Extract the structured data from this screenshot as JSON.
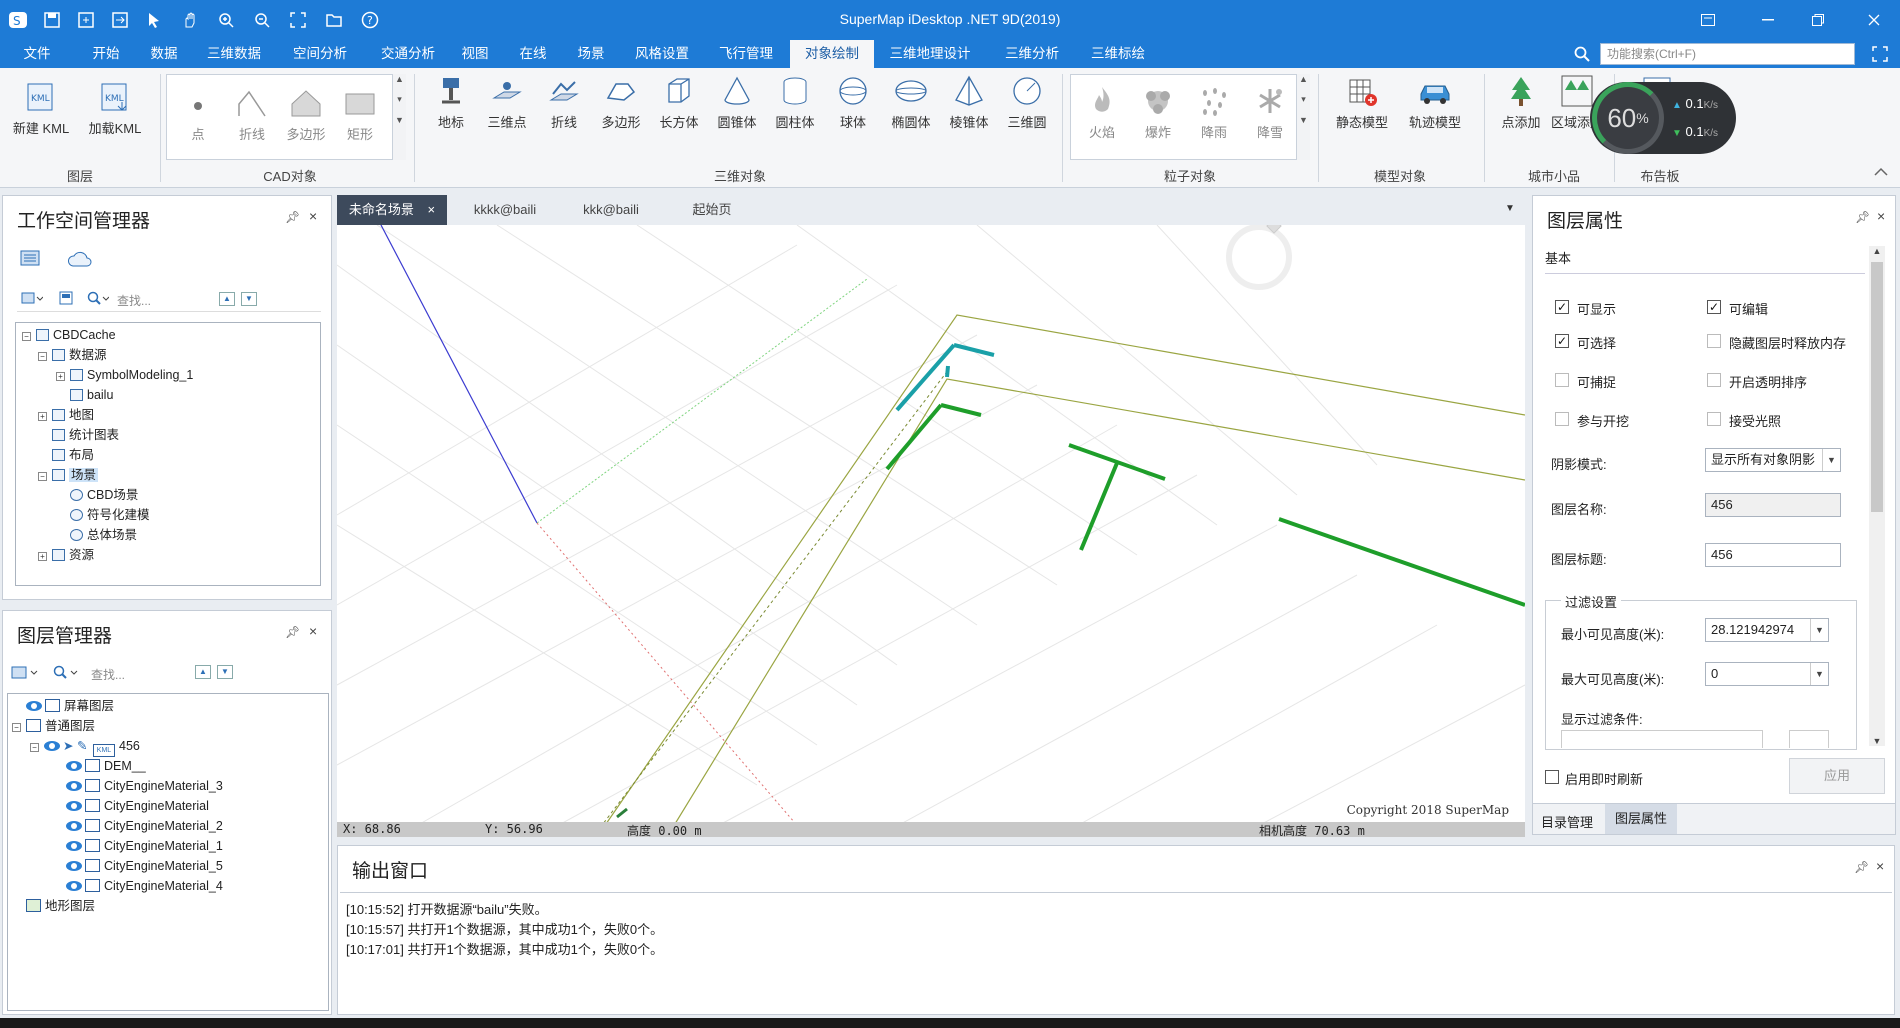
{
  "window": {
    "title": "SuperMap iDesktop .NET 9D(2019)"
  },
  "menu": {
    "items": [
      "文件",
      "开始",
      "数据",
      "三维数据",
      "空间分析",
      "交通分析",
      "视图",
      "在线",
      "场景",
      "风格设置",
      "飞行管理",
      "对象绘制",
      "三维地理设计",
      "三维分析",
      "三维标绘"
    ],
    "active": "对象绘制",
    "search_placeholder": "功能搜索(Ctrl+F)"
  },
  "ribbon": {
    "layer_group": {
      "label": "图层",
      "buttons": [
        "新建 KML",
        "加载KML"
      ]
    },
    "cad_group": {
      "label": "CAD对象",
      "buttons": [
        "点",
        "折线",
        "多边形",
        "矩形"
      ]
    },
    "obj3d_group": {
      "label": "三维对象",
      "buttons": [
        "地标",
        "三维点",
        "折线",
        "多边形",
        "长方体",
        "圆锥体",
        "圆柱体",
        "球体",
        "椭圆体",
        "棱锥体",
        "三维圆"
      ]
    },
    "particle_group": {
      "label": "粒子对象",
      "buttons": [
        "火焰",
        "爆炸",
        "降雨",
        "降雪"
      ]
    },
    "model_group": {
      "label": "模型对象",
      "buttons": [
        "静态模型",
        "轨迹模型"
      ]
    },
    "city_group": {
      "label": "城市小品",
      "buttons": [
        "点添加",
        "区域添加"
      ]
    },
    "billboard_group": {
      "label": "布告板"
    },
    "net_meter": {
      "percent": "60",
      "unit": "%",
      "up": "0.1",
      "down": "0.1",
      "rate_unit": "K/s"
    }
  },
  "workspace": {
    "title": "工作空间管理器",
    "search_placeholder": "查找...",
    "tree": [
      {
        "label": "CBDCache",
        "level": 0,
        "exp": "−"
      },
      {
        "label": "数据源",
        "level": 1,
        "exp": "−"
      },
      {
        "label": "SymbolModeling_1",
        "level": 2,
        "exp": "+"
      },
      {
        "label": "bailu",
        "level": 2,
        "exp": ""
      },
      {
        "label": "地图",
        "level": 1,
        "exp": "+"
      },
      {
        "label": "统计图表",
        "level": 1,
        "exp": ""
      },
      {
        "label": "布局",
        "level": 1,
        "exp": ""
      },
      {
        "label": "场景",
        "level": 1,
        "exp": "−",
        "selected": true
      },
      {
        "label": "CBD场景",
        "level": 2,
        "exp": ""
      },
      {
        "label": "符号化建模",
        "level": 2,
        "exp": ""
      },
      {
        "label": "总体场景",
        "level": 2,
        "exp": ""
      },
      {
        "label": "资源",
        "level": 1,
        "exp": "+"
      }
    ]
  },
  "layers": {
    "title": "图层管理器",
    "search_placeholder": "查找...",
    "tree": [
      {
        "label": "屏幕图层",
        "level": 0,
        "eye": true
      },
      {
        "label": "普通图层",
        "level": 0,
        "eye": false
      },
      {
        "label": "456",
        "level": 1,
        "eye": true,
        "kml": true
      },
      {
        "label": "DEM__",
        "level": 2,
        "eye": true
      },
      {
        "label": "CityEngineMaterial_3",
        "level": 2,
        "eye": true
      },
      {
        "label": "CityEngineMaterial",
        "level": 2,
        "eye": true
      },
      {
        "label": "CityEngineMaterial_2",
        "level": 2,
        "eye": true
      },
      {
        "label": "CityEngineMaterial_1",
        "level": 2,
        "eye": true
      },
      {
        "label": "CityEngineMaterial_5",
        "level": 2,
        "eye": true
      },
      {
        "label": "CityEngineMaterial_4",
        "level": 2,
        "eye": true
      },
      {
        "label": "地形图层",
        "level": 0,
        "eye": false
      }
    ]
  },
  "doc_tabs": [
    "未命名场景",
    "kkkk@baili",
    "kkk@baili",
    "起始页"
  ],
  "doc_tab_close": "×",
  "viewport": {
    "copyright": "Copyright 2018 SuperMap",
    "status": {
      "x": "X: 68.86",
      "y": "Y: 56.96",
      "height": "高度 0.00 m",
      "cam": "相机高度 70.63 m"
    }
  },
  "output": {
    "title": "输出窗口",
    "lines": [
      "[10:15:52] 打开数据源“bailu”失败。",
      "[10:15:57] 共打开1个数据源，其中成功1个，失败0个。",
      "[10:17:01] 共打开1个数据源，其中成功1个，失败0个。"
    ]
  },
  "props": {
    "title": "图层属性",
    "tab": "基本",
    "checks": [
      {
        "label": "可显示",
        "checked": true
      },
      {
        "label": "可编辑",
        "checked": true
      },
      {
        "label": "可选择",
        "checked": true
      },
      {
        "label": "隐藏图层时释放内存",
        "checked": false
      },
      {
        "label": "可捕捉",
        "checked": false
      },
      {
        "label": "开启透明排序",
        "checked": false
      },
      {
        "label": "参与开挖",
        "checked": false
      },
      {
        "label": "接受光照",
        "checked": false
      }
    ],
    "shadow_label": "阴影模式:",
    "shadow_value": "显示所有对象阴影",
    "name_label": "图层名称:",
    "name_value": "456",
    "caption_label": "图层标题:",
    "caption_value": "456",
    "filter_group": "过滤设置",
    "min_label": "最小可见高度(米):",
    "min_value": "28.121942974",
    "max_label": "最大可见高度(米):",
    "max_value": "0",
    "filter_cond": "显示过滤条件:",
    "realtime": "启用即时刷新",
    "apply": "应用",
    "bottom_tabs": [
      "目录管理",
      "图层属性"
    ]
  },
  "colors": {
    "accent": "#1e7bd6",
    "tab_active": "#3d4a5c"
  }
}
